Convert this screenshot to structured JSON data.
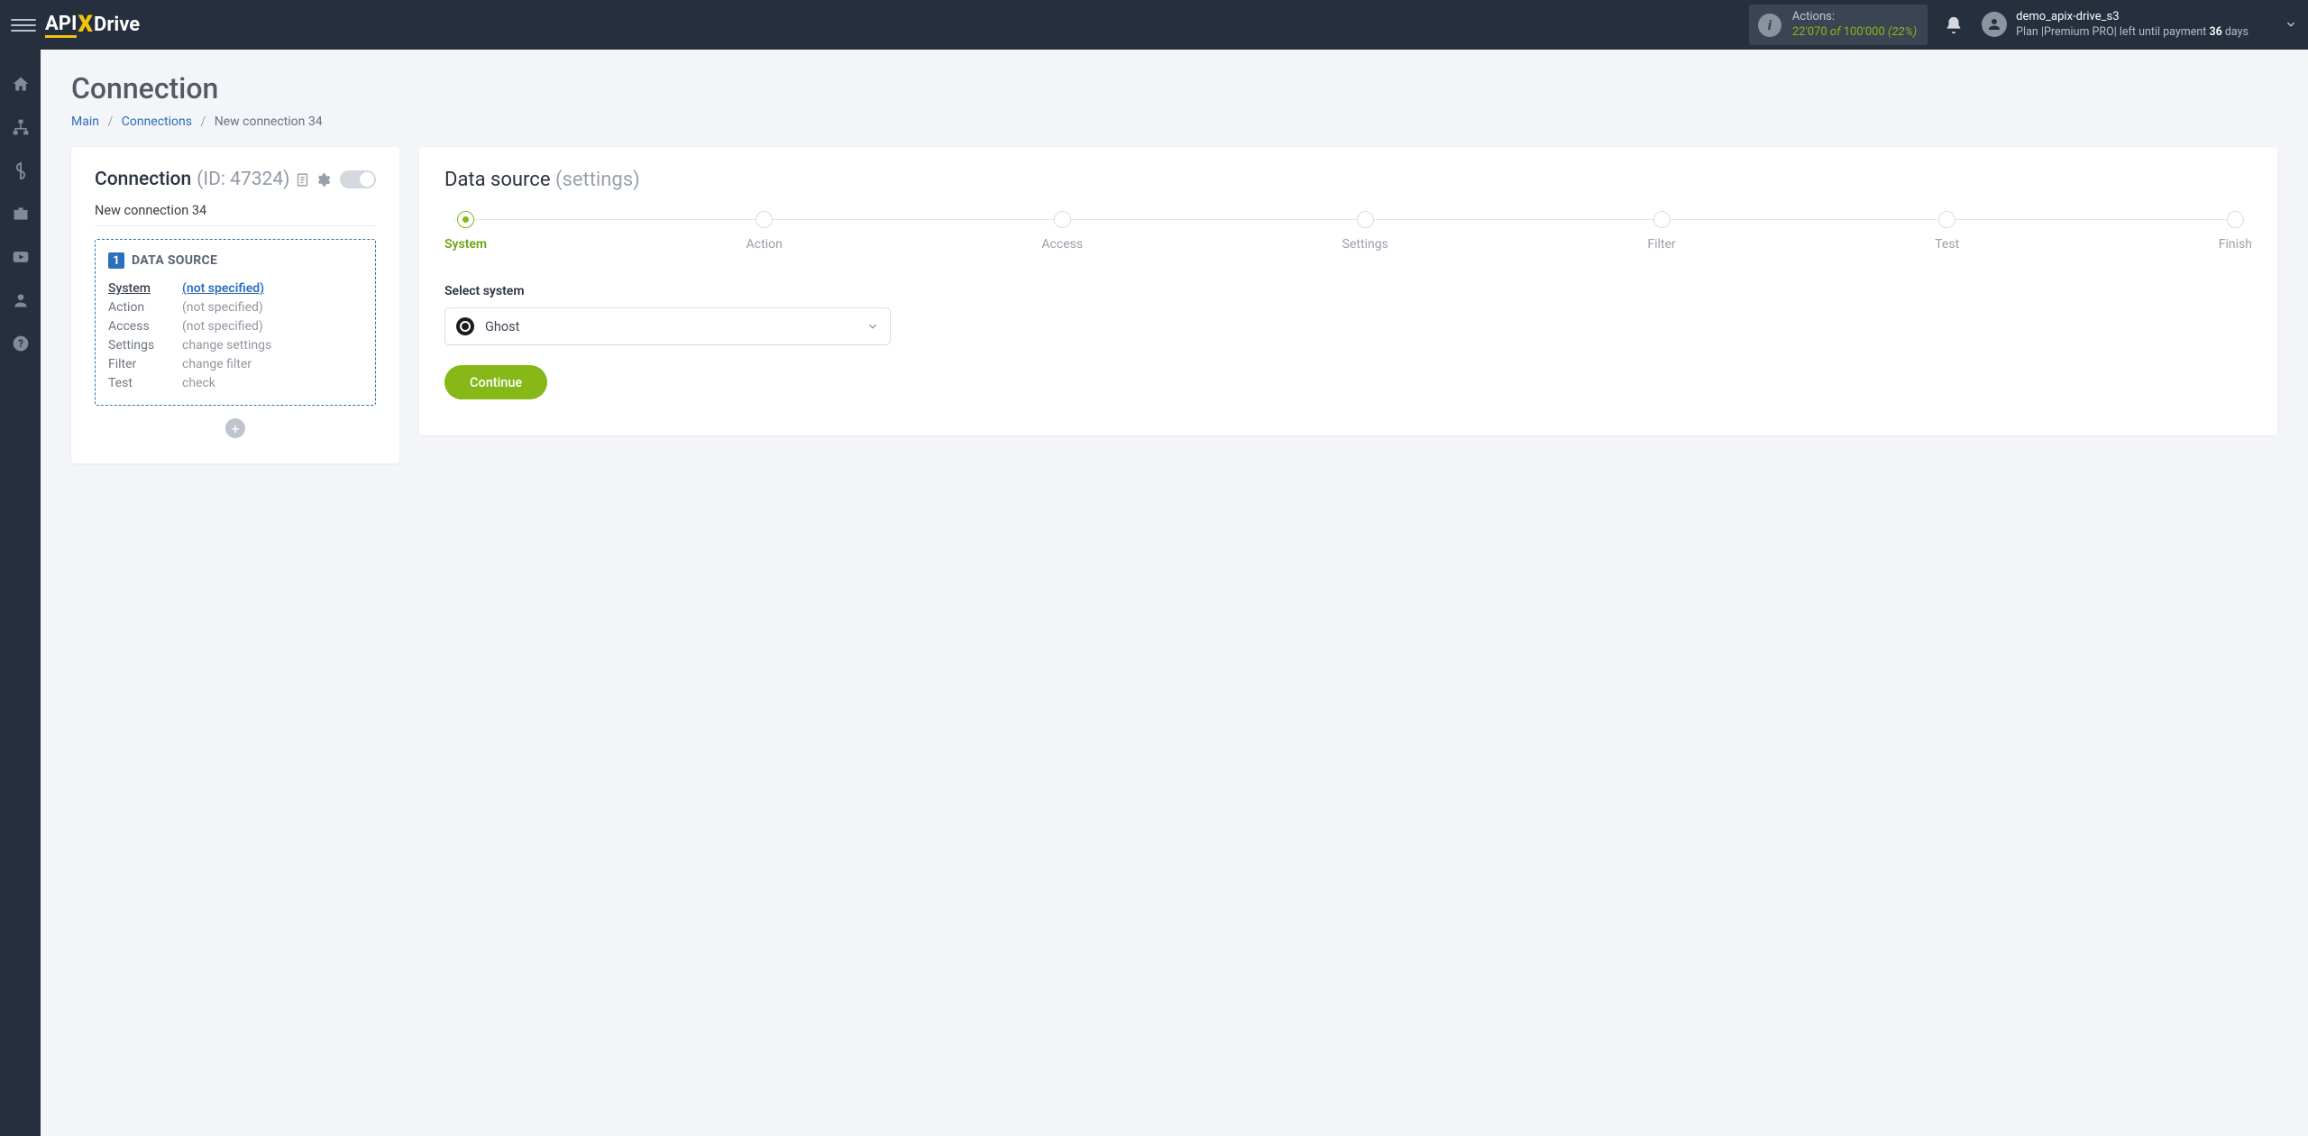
{
  "header": {
    "logo_api": "API",
    "logo_x": "X",
    "logo_drive": "Drive",
    "actions_label": "Actions:",
    "actions_used": "22'070",
    "actions_of": "of",
    "actions_total": "100'000",
    "actions_pct": "(22%)",
    "username": "demo_apix-drive_s3",
    "plan_prefix": "Plan |",
    "plan_name": "Premium PRO",
    "plan_mid": "| left until payment ",
    "plan_days": "36",
    "plan_suffix": " days"
  },
  "page": {
    "title": "Connection",
    "bc_main": "Main",
    "bc_connections": "Connections",
    "bc_current": "New connection 34"
  },
  "left": {
    "title": "Connection",
    "id_label": "(ID: 47324)",
    "conn_name": "New connection 34",
    "badge": "1",
    "ds_label": "DATA SOURCE",
    "rows": [
      {
        "k": "System",
        "v": "(not specified)",
        "active": true,
        "link": true
      },
      {
        "k": "Action",
        "v": "(not specified)"
      },
      {
        "k": "Access",
        "v": "(not specified)"
      },
      {
        "k": "Settings",
        "v": "change settings"
      },
      {
        "k": "Filter",
        "v": "change filter"
      },
      {
        "k": "Test",
        "v": "check"
      }
    ]
  },
  "right": {
    "title": "Data source",
    "subtitle": "(settings)",
    "steps": [
      "System",
      "Action",
      "Access",
      "Settings",
      "Filter",
      "Test",
      "Finish"
    ],
    "active_step": 0,
    "field_label": "Select system",
    "selected_system": "Ghost",
    "continue": "Continue"
  }
}
